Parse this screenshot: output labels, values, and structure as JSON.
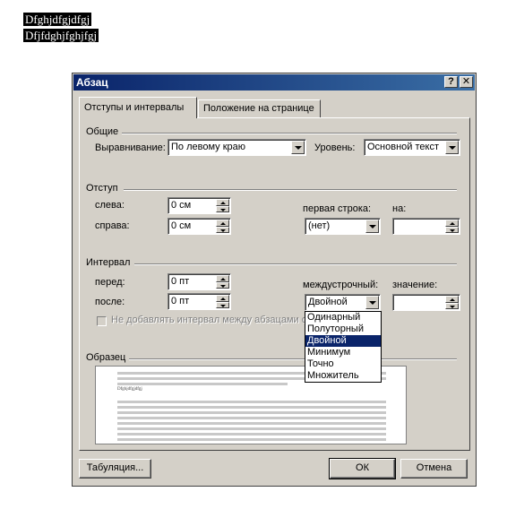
{
  "document": {
    "line1": "Dfghjdfgjdfgj",
    "line2": "Dfjfdghjfghjfgj"
  },
  "dialog": {
    "title": "Абзац",
    "help_button": "?",
    "close_button": "✕",
    "tabs": [
      {
        "label": "Отступы и интервалы",
        "active": true
      },
      {
        "label": "Положение на странице",
        "active": false
      }
    ],
    "general": {
      "group_label": "Общие",
      "alignment_label": "Выравнивание:",
      "alignment_value": "По левому краю",
      "level_label": "Уровень:",
      "level_value": "Основной текст"
    },
    "indent": {
      "group_label": "Отступ",
      "left_label": "слева:",
      "left_value": "0 см",
      "right_label": "справа:",
      "right_value": "0 см",
      "first_line_label": "первая строка:",
      "first_line_value": "(нет)",
      "by_label": "на:",
      "by_value": ""
    },
    "spacing": {
      "group_label": "Интервал",
      "before_label": "перед:",
      "before_value": "0 пт",
      "after_label": "после:",
      "after_value": "0 пт",
      "line_spacing_label": "междустрочный:",
      "line_spacing_value": "Двойной",
      "at_label": "значение:",
      "at_value": "",
      "dont_add_label": "Не добавлять интервал между абзацами о"
    },
    "line_spacing_options": [
      "Одинарный",
      "Полуторный",
      "Двойной",
      "Минимум",
      "Точно",
      "Множитель"
    ],
    "line_spacing_selected_index": 2,
    "preview": {
      "group_label": "Образец",
      "sample_text": "Dfghjdfgjdfgj"
    },
    "buttons": {
      "tabs": "Табуляция...",
      "ok": "ОК",
      "cancel": "Отмена"
    }
  },
  "colors": {
    "titlebar_start": "#0a246a",
    "titlebar_end": "#3a6ea5",
    "dialog_bg": "#d4d0c8",
    "selection": "#0a246a"
  }
}
